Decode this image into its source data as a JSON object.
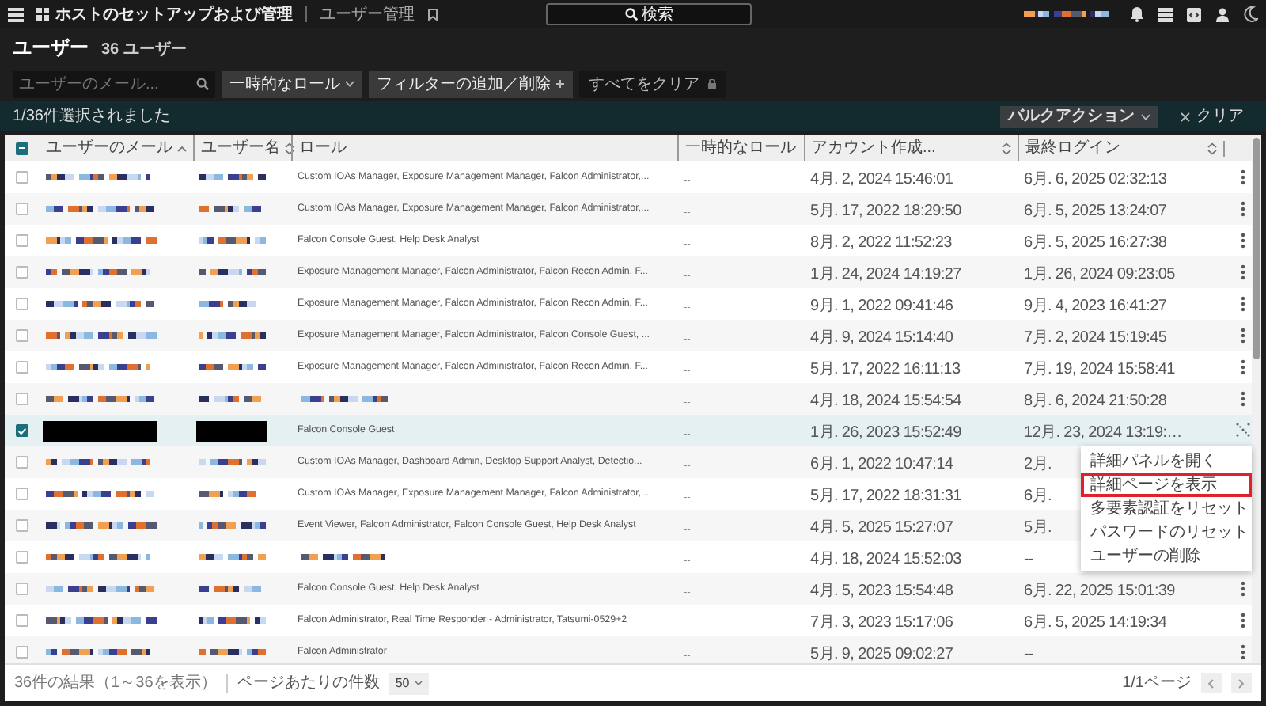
{
  "top_bar": {
    "app_title": "ホストのセットアップおよび管理",
    "breadcrumb": "ユーザー管理",
    "search_label": "検索"
  },
  "page_title": "ユーザー",
  "user_count": "36 ユーザー",
  "filters": {
    "search_placeholder": "ユーザーのメール...",
    "chips": [
      {
        "label": "一時的なロール",
        "kind": "dropdown"
      },
      {
        "label": "フィルターの追加／削除",
        "kind": "add"
      }
    ],
    "clear_all": "すべてをクリア"
  },
  "selection_bar": {
    "text": "1/36件選択されました",
    "bulk_action": "バルクアクション",
    "clear": "クリア"
  },
  "table": {
    "all_indeterminate": true,
    "columns": [
      {
        "label": "ユーザーのメール",
        "sorted_ascending": true,
        "sortable": false
      },
      {
        "label": "ユーザー名",
        "sorted_ascending": false,
        "sortable": true
      },
      {
        "label": "ロール",
        "sorted_ascending": false,
        "sortable": false
      },
      {
        "label": "一時的なロール",
        "sorted_ascending": false,
        "sortable": false
      },
      {
        "label": "アカウント作成...",
        "sorted_ascending": false,
        "sortable": true
      },
      {
        "label": "最終ログイン",
        "sorted_ascending": false,
        "sortable": true
      }
    ],
    "rows": [
      {
        "selected": false,
        "kind": "mosaic",
        "role": "Custom IOAs Manager, Exposure Management Manager, Falcon Administrator,...",
        "temporary_role": "--",
        "created": "4月. 2, 2024 15:46:01",
        "last_login": "6月. 6, 2025 02:32:13",
        "menu_open": false
      },
      {
        "selected": false,
        "kind": "mosaic",
        "role": "Custom IOAs Manager, Exposure Management Manager, Falcon Administrator,...",
        "temporary_role": "--",
        "created": "5月. 17, 2022 18:29:50",
        "last_login": "6月. 5, 2025 13:24:07",
        "menu_open": false
      },
      {
        "selected": false,
        "kind": "mosaic",
        "role": "Falcon Console Guest, Help Desk Analyst",
        "temporary_role": "--",
        "created": "8月. 2, 2022 11:52:23",
        "last_login": "6月. 5, 2025 16:27:38",
        "menu_open": false
      },
      {
        "selected": false,
        "kind": "mosaic",
        "role": "Exposure Management Manager, Falcon Administrator, Falcon Recon Admin, F...",
        "temporary_role": "--",
        "created": "1月. 24, 2024 14:19:27",
        "last_login": "1月. 26, 2024 09:23:05",
        "menu_open": false
      },
      {
        "selected": false,
        "kind": "mosaic",
        "role": "Exposure Management Manager, Falcon Administrator, Falcon Recon Admin, F...",
        "temporary_role": "--",
        "created": "9月. 1, 2022 09:41:46",
        "last_login": "9月. 4, 2023 16:41:27",
        "menu_open": false
      },
      {
        "selected": false,
        "kind": "mosaic",
        "role": "Exposure Management Manager, Falcon Administrator, Falcon Console Guest, ...",
        "temporary_role": "--",
        "created": "4月. 9, 2024 15:14:40",
        "last_login": "7月. 2, 2024 15:19:45",
        "menu_open": false
      },
      {
        "selected": false,
        "kind": "mosaic",
        "role": "Exposure Management Manager, Falcon Administrator, Falcon Recon Admin, F...",
        "temporary_role": "--",
        "created": "5月. 17, 2022 16:11:13",
        "last_login": "7月. 19, 2024 15:58:41",
        "menu_open": false
      },
      {
        "selected": false,
        "kind": "mosaic",
        "temporary_role": "--",
        "created": "4月. 18, 2024 15:54:54",
        "last_login": "8月. 6, 2024 21:50:28",
        "menu_open": false
      },
      {
        "selected": true,
        "kind": "black",
        "role": "Falcon Console Guest",
        "temporary_role": "--",
        "created": "1月. 26, 2023 15:52:49",
        "last_login": "12月. 23, 2024 13:19:…",
        "menu_open": true
      },
      {
        "selected": false,
        "kind": "mosaic",
        "role": "Custom IOAs Manager, Dashboard Admin, Desktop Support Analyst, Detectio...",
        "temporary_role": "--",
        "created": "6月. 1, 2022 10:47:14",
        "last_login": "2月.",
        "actions_hidden": true
      },
      {
        "selected": false,
        "kind": "mosaic",
        "role": "Custom IOAs Manager, Exposure Management Manager, Falcon Administrator,...",
        "temporary_role": "--",
        "created": "5月. 17, 2022 18:31:31",
        "last_login": "6月.",
        "actions_hidden": true
      },
      {
        "selected": false,
        "kind": "mosaic",
        "role": "Event Viewer, Falcon Administrator, Falcon Console Guest, Help Desk Analyst",
        "temporary_role": "--",
        "created": "4月. 5, 2025 15:27:07",
        "last_login": "5月.",
        "actions_hidden": true
      },
      {
        "selected": false,
        "kind": "mosaic",
        "temporary_role": "--",
        "created": "4月. 18, 2024 15:52:03",
        "last_login": "--",
        "actions_hidden": true
      },
      {
        "selected": false,
        "kind": "mosaic",
        "role": "Falcon Console Guest, Help Desk Analyst",
        "temporary_role": "--",
        "created": "4月. 5, 2023 15:54:48",
        "last_login": "6月. 22, 2025 15:01:39",
        "menu_open": false
      },
      {
        "selected": false,
        "kind": "mosaic",
        "role": "Falcon Administrator, Real Time Responder - Administrator, Tatsumi-0529+2",
        "temporary_role": "--",
        "created": "7月. 3, 2023 15:17:06",
        "last_login": "6月. 5, 2025 14:19:34",
        "menu_open": false
      },
      {
        "selected": false,
        "kind": "mosaic",
        "role": "Falcon Administrator",
        "temporary_role": "--",
        "created": "5月. 9, 2025 09:02:27",
        "last_login": "--",
        "menu_open": false
      }
    ]
  },
  "context_menu": [
    {
      "label": "詳細パネルを開く",
      "highlighted": false
    },
    {
      "label": "詳細ページを表示",
      "highlighted": true
    },
    {
      "label": "多要素認証をリセット",
      "highlighted": false
    },
    {
      "label": "パスワードのリセット",
      "highlighted": false
    },
    {
      "label": "ユーザーの削除",
      "highlighted": false
    }
  ],
  "footer": {
    "results": "36件の結果（1～36を表示）",
    "per_page_label": "ページあたりの件数",
    "per_page": "50",
    "page": "1/1ページ",
    "prev_disabled": true,
    "next_disabled": true
  }
}
